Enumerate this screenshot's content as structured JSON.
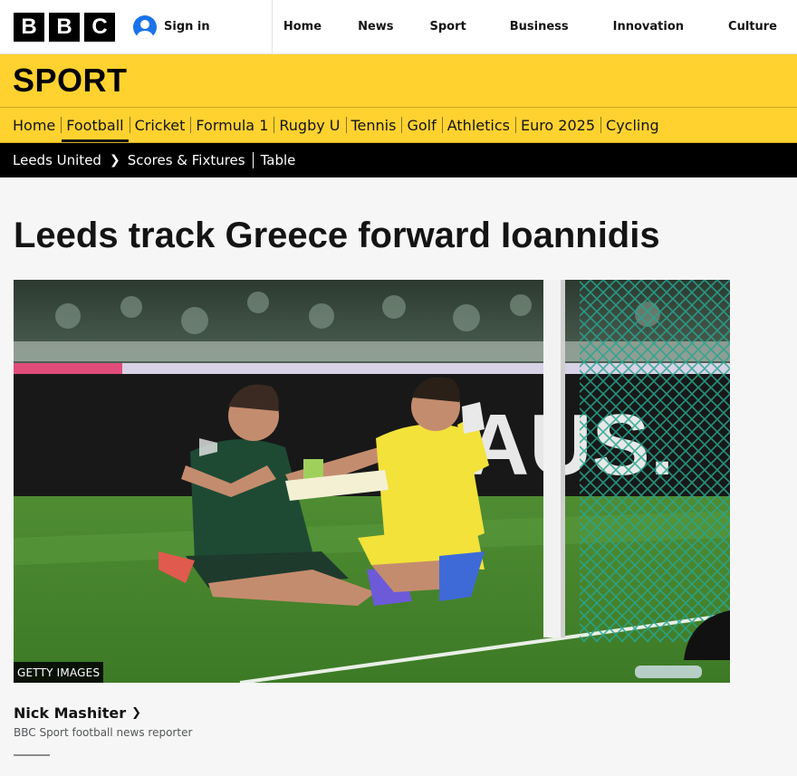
{
  "masthead": {
    "logo_letters": [
      "B",
      "B",
      "C"
    ],
    "signin_label": "Sign in",
    "nav": [
      "Home",
      "News",
      "Sport",
      "Business",
      "Innovation",
      "Culture"
    ]
  },
  "sport": {
    "title": "SPORT",
    "nav": [
      "Home",
      "Football",
      "Cricket",
      "Formula 1",
      "Rugby U",
      "Tennis",
      "Golf",
      "Athletics",
      "Euro 2025",
      "Cycling"
    ],
    "active": "Football"
  },
  "subnav": {
    "team": "Leeds United",
    "links": [
      "Scores & Fixtures",
      "Table"
    ]
  },
  "article": {
    "headline": "Leeds track Greece forward Ioannidis",
    "image_credit": "GETTY IMAGES",
    "author": "Nick Mashiter",
    "author_role": "BBC Sport football news reporter"
  },
  "colors": {
    "sport_yellow": "#ffd230",
    "subnav_black": "#000000",
    "signin_blue": "#1a73e8"
  },
  "icons": {
    "signin": "user-circle-icon",
    "subnav_separator": "chevron-right-icon",
    "author_link": "chevron-right-icon"
  }
}
